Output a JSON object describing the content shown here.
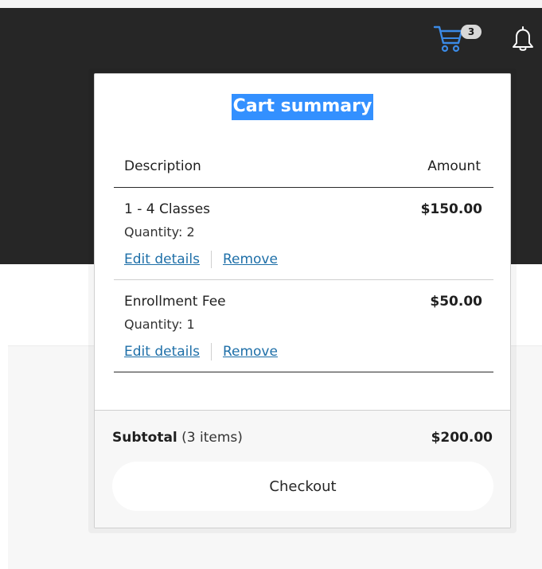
{
  "header": {
    "cart_badge_count": "3",
    "cart_icon": "shopping-cart-icon",
    "bell_icon": "bell-icon",
    "cart_icon_color": "#3b8ae6"
  },
  "cart_summary": {
    "title": "Cart summary",
    "columns": {
      "description": "Description",
      "amount": "Amount"
    },
    "items": [
      {
        "name": "1 - 4 Classes",
        "quantity": "Quantity: 2",
        "amount": "$150.00",
        "edit_label": "Edit details",
        "remove_label": "Remove"
      },
      {
        "name": "Enrollment Fee",
        "quantity": "Quantity: 1",
        "amount": "$50.00",
        "edit_label": "Edit details",
        "remove_label": "Remove"
      }
    ],
    "subtotal_label": "Subtotal",
    "subtotal_count": "(3 items)",
    "subtotal_amount": "$200.00",
    "checkout_label": "Checkout"
  },
  "colors": {
    "header_bg": "#262626",
    "title_highlight": "#3390ff",
    "link": "#1e6fa8"
  }
}
